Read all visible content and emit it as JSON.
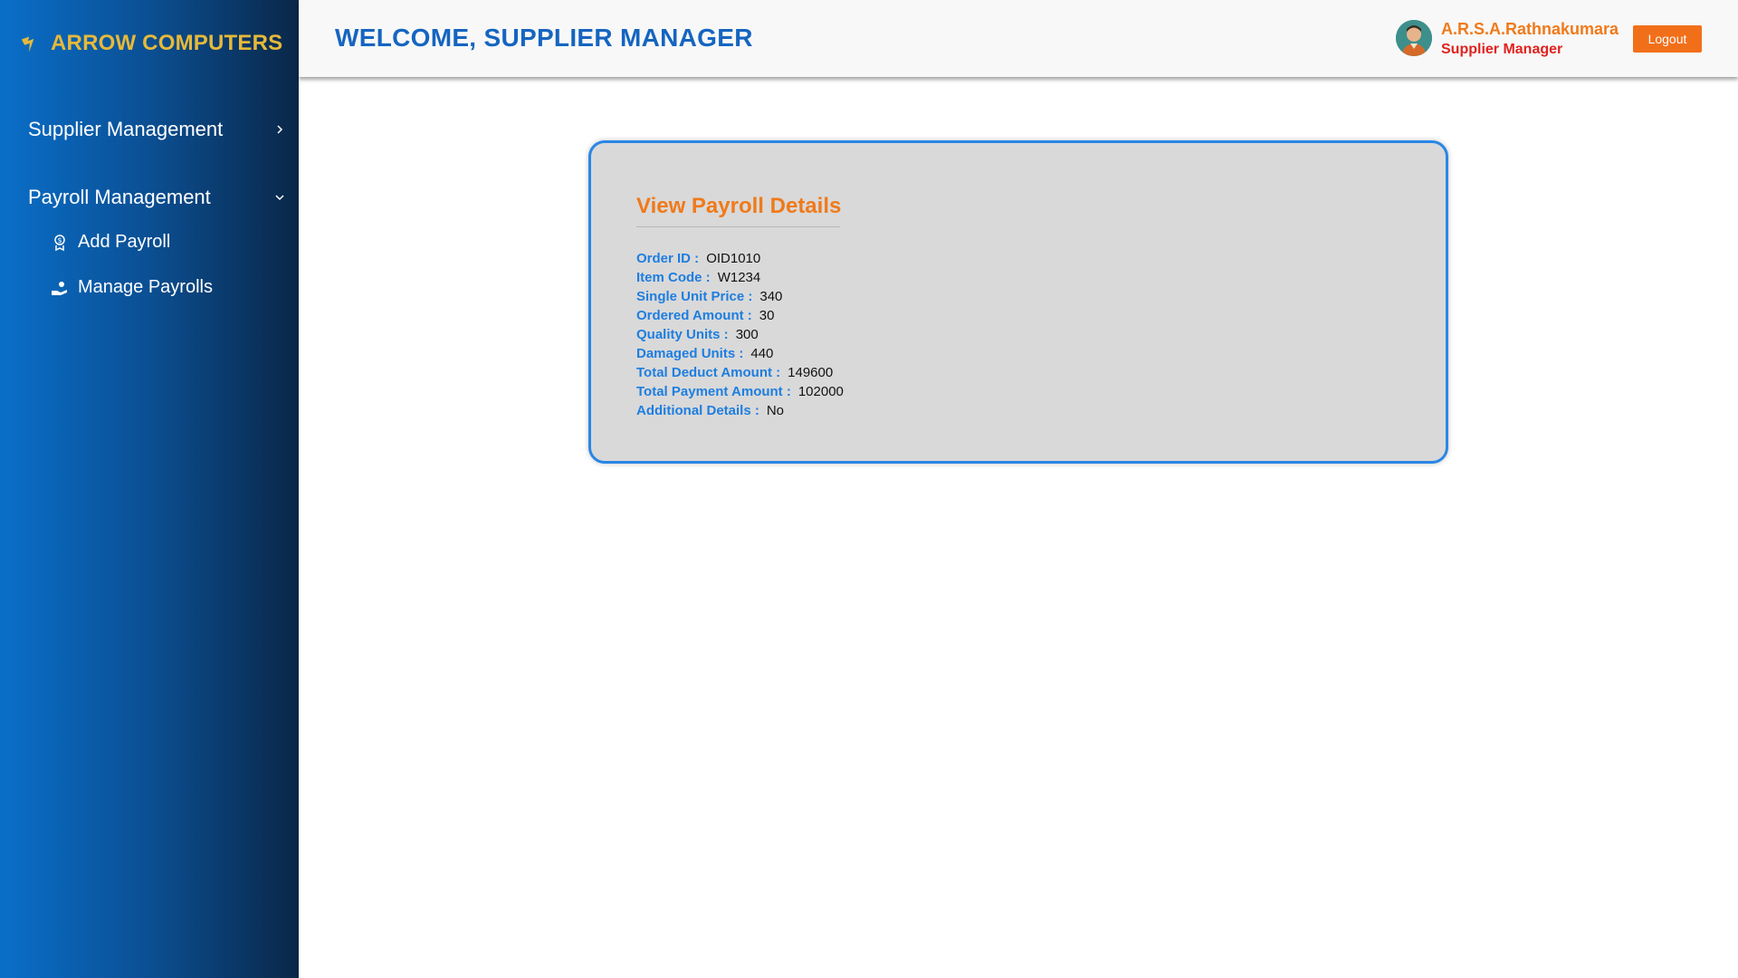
{
  "sidebar": {
    "brand": "ARROW COMPUTERS",
    "nav": [
      {
        "label": "Supplier Management",
        "icon": "chevron-right-icon",
        "expanded": false
      },
      {
        "label": "Payroll Management",
        "icon": "chevron-down-icon",
        "expanded": true,
        "children": [
          {
            "label": "Add Payroll",
            "icon": "add-payroll-icon"
          },
          {
            "label": "Manage Payrolls",
            "icon": "manage-payrolls-icon"
          }
        ]
      }
    ]
  },
  "header": {
    "welcome": "WELCOME, SUPPLIER MANAGER",
    "user_name": "A.R.S.A.Rathnakumara",
    "user_role": "Supplier Manager",
    "logout_label": "Logout"
  },
  "card": {
    "title": "View Payroll Details",
    "fields": [
      {
        "label": "Order ID :",
        "value": "OID1010"
      },
      {
        "label": "Item Code :",
        "value": "W1234"
      },
      {
        "label": "Single Unit Price :",
        "value": "340"
      },
      {
        "label": "Ordered Amount :",
        "value": "30"
      },
      {
        "label": "Quality Units :",
        "value": "300"
      },
      {
        "label": "Damaged Units :",
        "value": "440"
      },
      {
        "label": "Total Deduct Amount :",
        "value": "149600"
      },
      {
        "label": "Total Payment Amount :",
        "value": "102000"
      },
      {
        "label": "Additional Details :",
        "value": "No"
      }
    ]
  },
  "colors": {
    "brand": "#e6b93a",
    "accent_blue": "#1565c0",
    "accent_orange": "#f07a1a",
    "role_red": "#e0231f",
    "card_border": "#2a86e6"
  }
}
